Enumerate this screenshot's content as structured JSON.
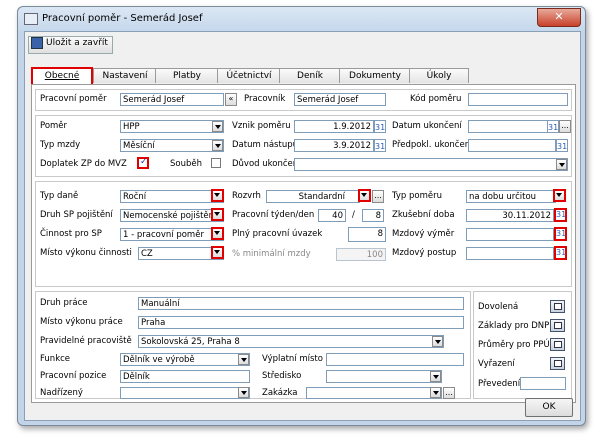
{
  "window": {
    "title": "Pracovní poměr - Semerád Josef",
    "close": "✕"
  },
  "toolbar": {
    "save_label": "Uložit a zavřít"
  },
  "tabs": [
    {
      "label": "Obecné"
    },
    {
      "label": "Nastavení"
    },
    {
      "label": "Platby"
    },
    {
      "label": "Účetnictví"
    },
    {
      "label": "Deník"
    },
    {
      "label": "Dokumenty"
    },
    {
      "label": "Úkoly"
    }
  ],
  "top": {
    "pracovni_pomer_label": "Pracovní poměr",
    "pracovni_pomer_value": "Semerád Josef",
    "pp_btn": "«",
    "pracovnik_label": "Pracovník",
    "pracovnik_value": "Semerád Josef",
    "kod_pomeru_label": "Kód poměru",
    "kod_pomeru_value": ""
  },
  "mid": {
    "pomer_label": "Poměr",
    "pomer_value": "HPP",
    "typ_mzdy_label": "Typ mzdy",
    "typ_mzdy_value": "Měsíční",
    "doplatek_label": "Doplatek ZP do MVZ",
    "doplatek_check": "✓",
    "soubeh_label": "Souběh",
    "vznik_label": "Vznik poměru",
    "vznik_value": "1.9.2012",
    "nastup_label": "Datum nástupu",
    "nastup_value": "3.9.2012",
    "duvod_label": "Důvod ukončení",
    "duvod_value": "",
    "ukonceni_label": "Datum ukončení",
    "ukonceni_value": "",
    "predpokl_label": "Předpokl. ukončení",
    "predpokl_value": "",
    "cal": "31",
    "dots": "..."
  },
  "tax": {
    "typ_dane_label": "Typ daně",
    "typ_dane_value": "Roční",
    "druh_sp_label": "Druh SP pojištění",
    "druh_sp_value": "Nemocenské pojištění",
    "cinnost_label": "Činnost pro SP",
    "cinnost_value": "1 - pracovní poměr",
    "misto_cinnosti_label": "Místo výkonu činnosti",
    "misto_cinnosti_value": "CZ",
    "rozvrh_label": "Rozvrh",
    "rozvrh_value": "Standardní",
    "tyden_label": "Pracovní týden/den",
    "tyden_value": "40",
    "slash": "/",
    "den_value": "8",
    "uvazek_label": "Plný pracovní úvazek",
    "uvazek_value": "8",
    "min_mzda_label": "% minimální mzdy",
    "min_mzda_value": "100",
    "typ_pomeru_label": "Typ poměru",
    "typ_pomeru_value": "na dobu určitou",
    "zkusebni_label": "Zkušební doba",
    "zkusebni_value": "30.11.2012",
    "vymer_label": "Mzdový výměr",
    "vymer_value": "",
    "postup_label": "Mzdový postup",
    "postup_value": ""
  },
  "work": {
    "druh_prace_label": "Druh práce",
    "druh_prace_value": "Manuální",
    "misto_prace_label": "Místo výkonu práce",
    "misto_prace_value": "Praha",
    "pravidelne_label": "Pravidelné pracoviště",
    "pravidelne_value": "Sokolovská 25, Praha 8",
    "funkce_label": "Funkce",
    "funkce_value": "Dělník ve výrobě",
    "pozice_label": "Pracovní pozice",
    "pozice_value": "Dělník",
    "nadrizeny_label": "Nadřízený",
    "nadrizeny_value": "",
    "vyplatni_label": "Výplatní místo",
    "vyplatni_value": "",
    "stredisko_label": "Středisko",
    "stredisko_value": "",
    "zakazka_label": "Zakázka",
    "zakazka_value": ""
  },
  "right": {
    "dovolena": "Dovolená",
    "zaklady": "Základy pro DNP",
    "prumery": "Průměry pro PPÚ",
    "vyrazeni": "Vyřazení",
    "prevedeni": "Převedení",
    "prevedeni_value": ""
  },
  "ok": "OK"
}
